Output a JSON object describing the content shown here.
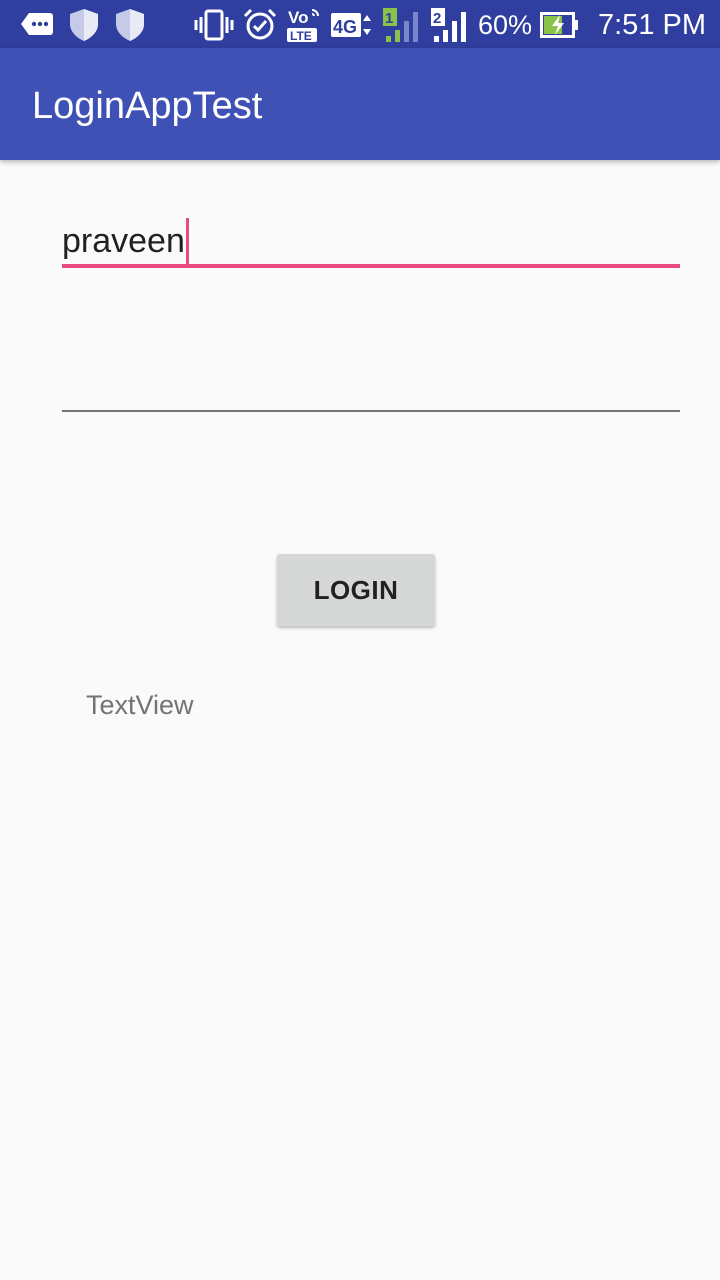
{
  "status_bar": {
    "battery_percent": "60%",
    "time": "7:51 PM",
    "volte_top": "Vo",
    "volte_bottom": "LTE",
    "network_type": "4G",
    "sim1": "1",
    "sim2": "2",
    "icons": [
      "chat-bubble-icon",
      "shield-icon",
      "shield-icon",
      "vibrate-icon",
      "alarm-icon",
      "volte-icon",
      "4g-data-icon",
      "sim1-signal-icon",
      "sim2-signal-icon",
      "battery-charging-icon"
    ]
  },
  "app_bar": {
    "title": "LoginAppTest"
  },
  "form": {
    "username_value": "praveen",
    "password_value": "",
    "login_button_label": "LOGIN",
    "result_text": "TextView"
  },
  "colors": {
    "status_bar": "#303f9f",
    "app_bar": "#3f51b5",
    "accent": "#e84a82",
    "background": "#fafafa",
    "button": "#d6d7d7"
  }
}
